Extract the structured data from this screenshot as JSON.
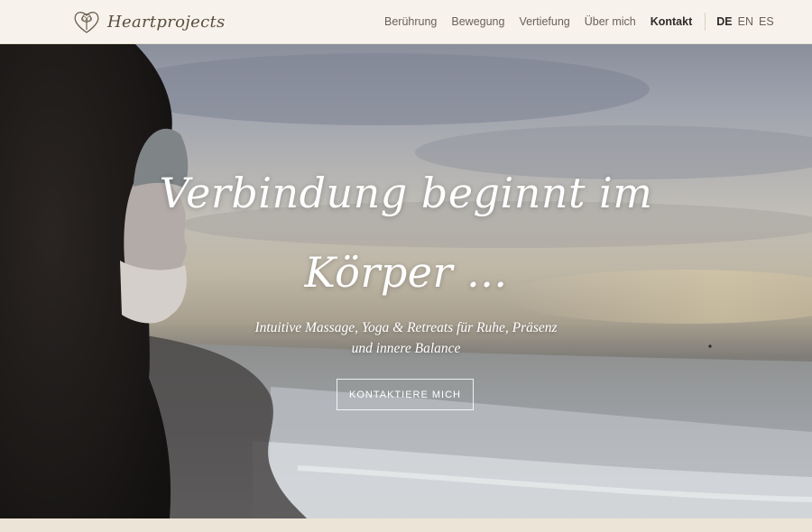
{
  "header": {
    "brand_name": "Heartprojects",
    "logo_icon": "heart-tree-icon",
    "nav": [
      {
        "label": "Berührung"
      },
      {
        "label": "Bewegung"
      },
      {
        "label": "Vertiefung"
      },
      {
        "label": "Über mich"
      },
      {
        "label": "Kontakt",
        "active": true
      }
    ],
    "languages": [
      {
        "label": "DE",
        "active": true
      },
      {
        "label": "EN"
      },
      {
        "label": "ES"
      }
    ]
  },
  "hero": {
    "title_line1": "Verbindung beginnt im",
    "title_line2": "Körper ...",
    "subtitle": "Intuitive Massage, Yoga & Retreats für Ruhe, Präsenz und innere Balance",
    "cta_label": "KONTAKTIERE MICH"
  },
  "colors": {
    "header_bg": "#f7f3ec",
    "nav_text": "#6a6058",
    "nav_active": "#2f2a25",
    "hero_text": "#ffffff",
    "page_bg": "#ece4d6"
  }
}
